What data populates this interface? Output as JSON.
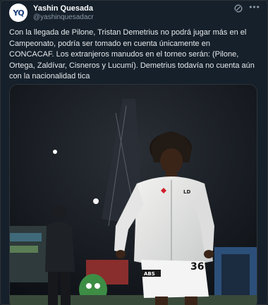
{
  "author": {
    "avatar_text": "YQ",
    "name": "Yashin Quesada",
    "handle": "@yashinquesadacr"
  },
  "tweet": {
    "text": "Con la llegada de Pilone, Tristan Demetrius no podrá jugar más en el Campeonato, podría ser tomado en cuenta únicamente en CONCACAF. Los extranjeros manudos en el torneo serán: (Pilone, Ortega, Zaldívar, Cisneros y Lucumí). Demetrius todavía no cuenta aún con la nacionalidad tica"
  },
  "icons": {
    "grok": "grok-icon",
    "more": "more-icon"
  },
  "media": {
    "shirt_text": "LD",
    "shorts_number": "36",
    "shorts_text": "ABS"
  },
  "colors": {
    "background": "#15202b",
    "text": "#e7e9ea",
    "secondary": "#8b98a5",
    "border": "#2f3336"
  }
}
